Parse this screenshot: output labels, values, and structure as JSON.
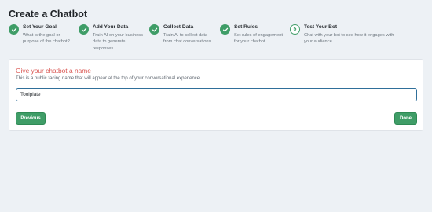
{
  "page": {
    "title": "Create a Chatbot"
  },
  "steps": [
    {
      "number": "1",
      "state": "done",
      "icon": "check-icon",
      "title": "Set Your Goal",
      "desc_lines": [
        "What is the goal or",
        "purpose of the chatbot?"
      ]
    },
    {
      "number": "2",
      "state": "done",
      "icon": "check-icon",
      "title": "Add Your Data",
      "desc_lines": [
        "Train AI on your business",
        "data to generate",
        "responses."
      ]
    },
    {
      "number": "3",
      "state": "done",
      "icon": "check-icon",
      "title": "Collect Data",
      "desc_lines": [
        "Train AI to collect data",
        "from chat conversations."
      ]
    },
    {
      "number": "4",
      "state": "done",
      "icon": "check-icon",
      "title": "Set Rules",
      "desc_lines": [
        "Set rules of engagement",
        "for your chatbot."
      ]
    },
    {
      "number": "5",
      "state": "current",
      "icon": "",
      "title": "Test Your Bot",
      "desc_lines": [
        "Chat with your bot to see how it engages with",
        "your audience"
      ]
    }
  ],
  "form": {
    "heading": "Give your chatbot a name",
    "subtext": "This is a public facing name that will appear at the top of your conversational experience.",
    "name_value": "Toolplate",
    "previous_label": "Previous",
    "done_label": "Done"
  },
  "colors": {
    "accent_green": "#3f9d67",
    "heading_red": "#d9534f",
    "input_border": "#2f6f9a",
    "background": "#edf1f5"
  }
}
